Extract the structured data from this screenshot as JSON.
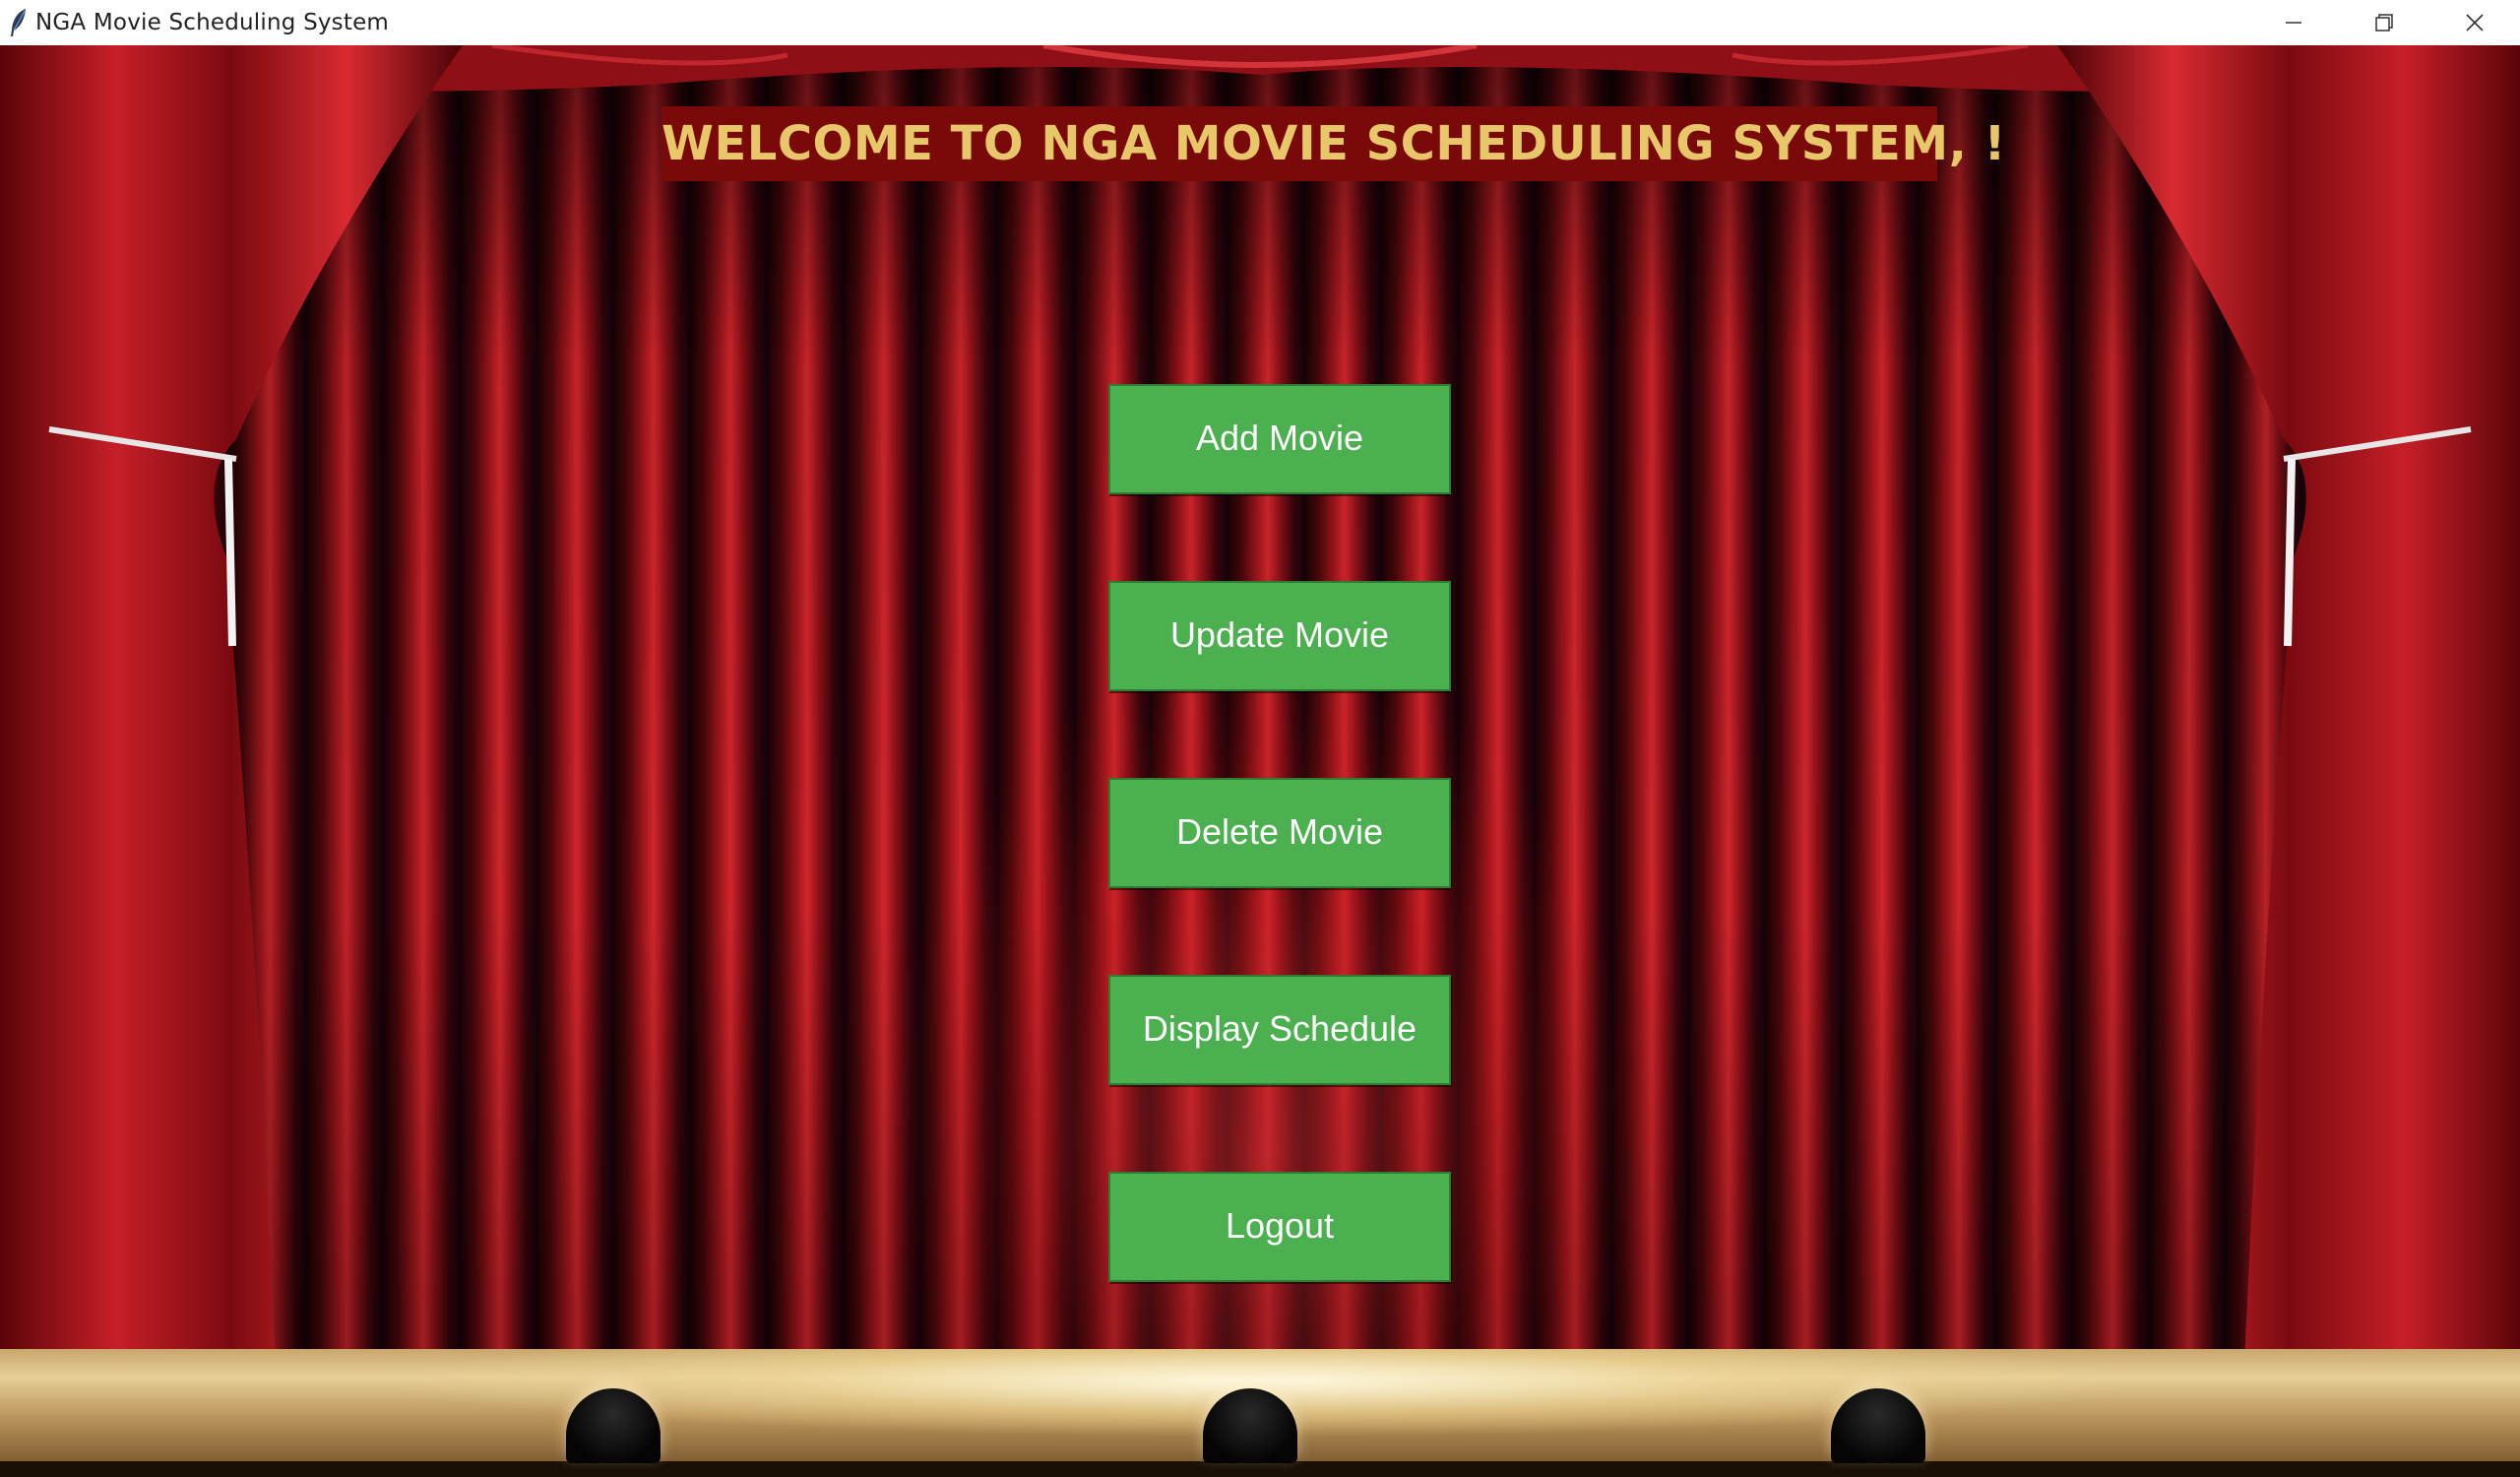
{
  "window": {
    "title": "NGA Movie Scheduling System",
    "controls": {
      "minimize_icon": "minimize-icon",
      "restore_icon": "restore-icon",
      "close_icon": "close-icon"
    }
  },
  "banner": {
    "text": "WELCOME TO NGA MOVIE SCHEDULING SYSTEM, !",
    "text_color": "#e8c66a",
    "background_color": "#7a0a0a"
  },
  "menu": {
    "button_color": "#4caf50",
    "add_movie": "Add Movie",
    "update_movie": "Update Movie",
    "delete_movie": "Delete Movie",
    "display_schedule": "Display Schedule",
    "logout": "Logout"
  },
  "background": {
    "theme": "theater-stage-curtains"
  }
}
